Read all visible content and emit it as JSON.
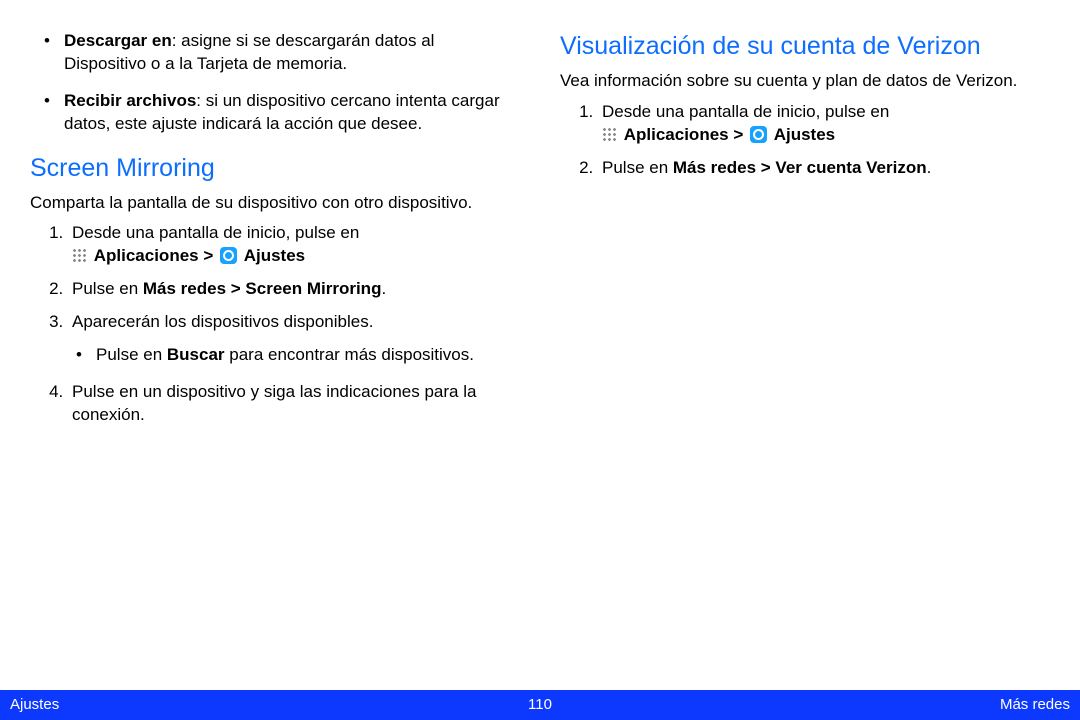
{
  "left": {
    "bullets": [
      {
        "lead": "Descargar en",
        "rest": ": asigne si se descargarán datos al Dispositivo o a la Tarjeta de memoria."
      },
      {
        "lead": "Recibir archivos",
        "rest": ": si un dispositivo cercano intenta cargar datos, este ajuste indicará la acción que desee."
      }
    ],
    "heading": "Screen Mirroring",
    "intro": "Comparta la pantalla de su dispositivo con otro dispositivo.",
    "step1_lead": "Desde una pantalla de inicio, pulse en ",
    "apps_label": "Aplicaciones > ",
    "settings_label": " Ajustes",
    "step2_pre": "Pulse en ",
    "step2_bold": "Más redes > Screen Mirroring",
    "step2_post": ".",
    "step3": "Aparecerán los dispositivos disponibles.",
    "step3_sub_pre": "Pulse en ",
    "step3_sub_bold": "Buscar",
    "step3_sub_post": " para encontrar más dispositivos.",
    "step4": "Pulse en un dispositivo y siga las indicaciones para la conexión."
  },
  "right": {
    "heading": "Visualización de su cuenta de Verizon",
    "intro": "Vea información sobre su cuenta y plan de datos de Verizon.",
    "step1_lead": "Desde una pantalla de inicio, pulse en ",
    "apps_label": "Aplicaciones > ",
    "settings_label": " Ajustes",
    "step2_pre": "Pulse en ",
    "step2_bold": "Más redes > Ver cuenta Verizon",
    "step2_post": "."
  },
  "footer": {
    "left": "Ajustes",
    "center": "110",
    "right": "Más redes"
  }
}
